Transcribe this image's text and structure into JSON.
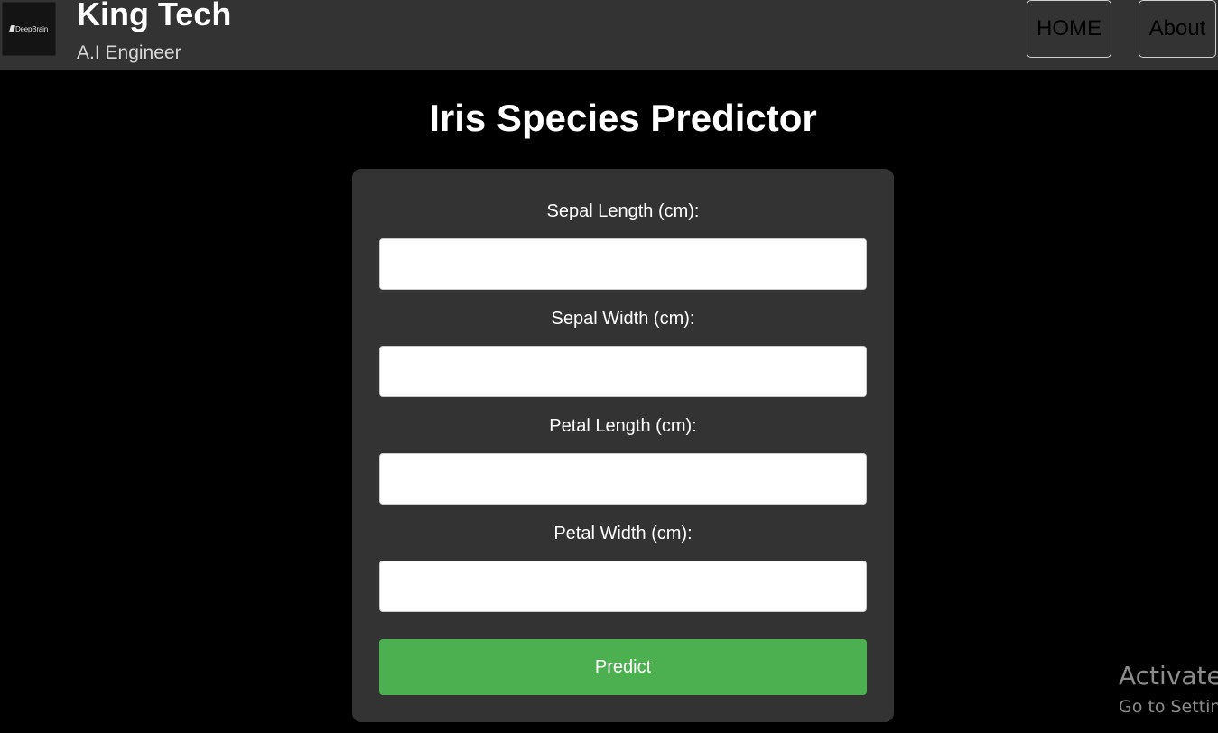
{
  "header": {
    "logo_text": "DeepBrain",
    "title": "King Tech",
    "subtitle": "A.I Engineer",
    "nav": [
      {
        "label": "HOME"
      },
      {
        "label": "About"
      }
    ]
  },
  "main": {
    "title": "Iris Species Predictor",
    "fields": [
      {
        "label": "Sepal Length (cm):",
        "value": "",
        "placeholder": ""
      },
      {
        "label": "Sepal Width (cm):",
        "value": "",
        "placeholder": ""
      },
      {
        "label": "Petal Length (cm):",
        "value": "",
        "placeholder": ""
      },
      {
        "label": "Petal Width (cm):",
        "value": "",
        "placeholder": ""
      }
    ],
    "submit_label": "Predict"
  },
  "watermark": {
    "title": "Activate",
    "subtitle": "Go to Settin"
  },
  "colors": {
    "background": "#000000",
    "header_bg": "#333333",
    "card_bg": "#333333",
    "accent": "#4caf50",
    "text": "#ffffff"
  }
}
